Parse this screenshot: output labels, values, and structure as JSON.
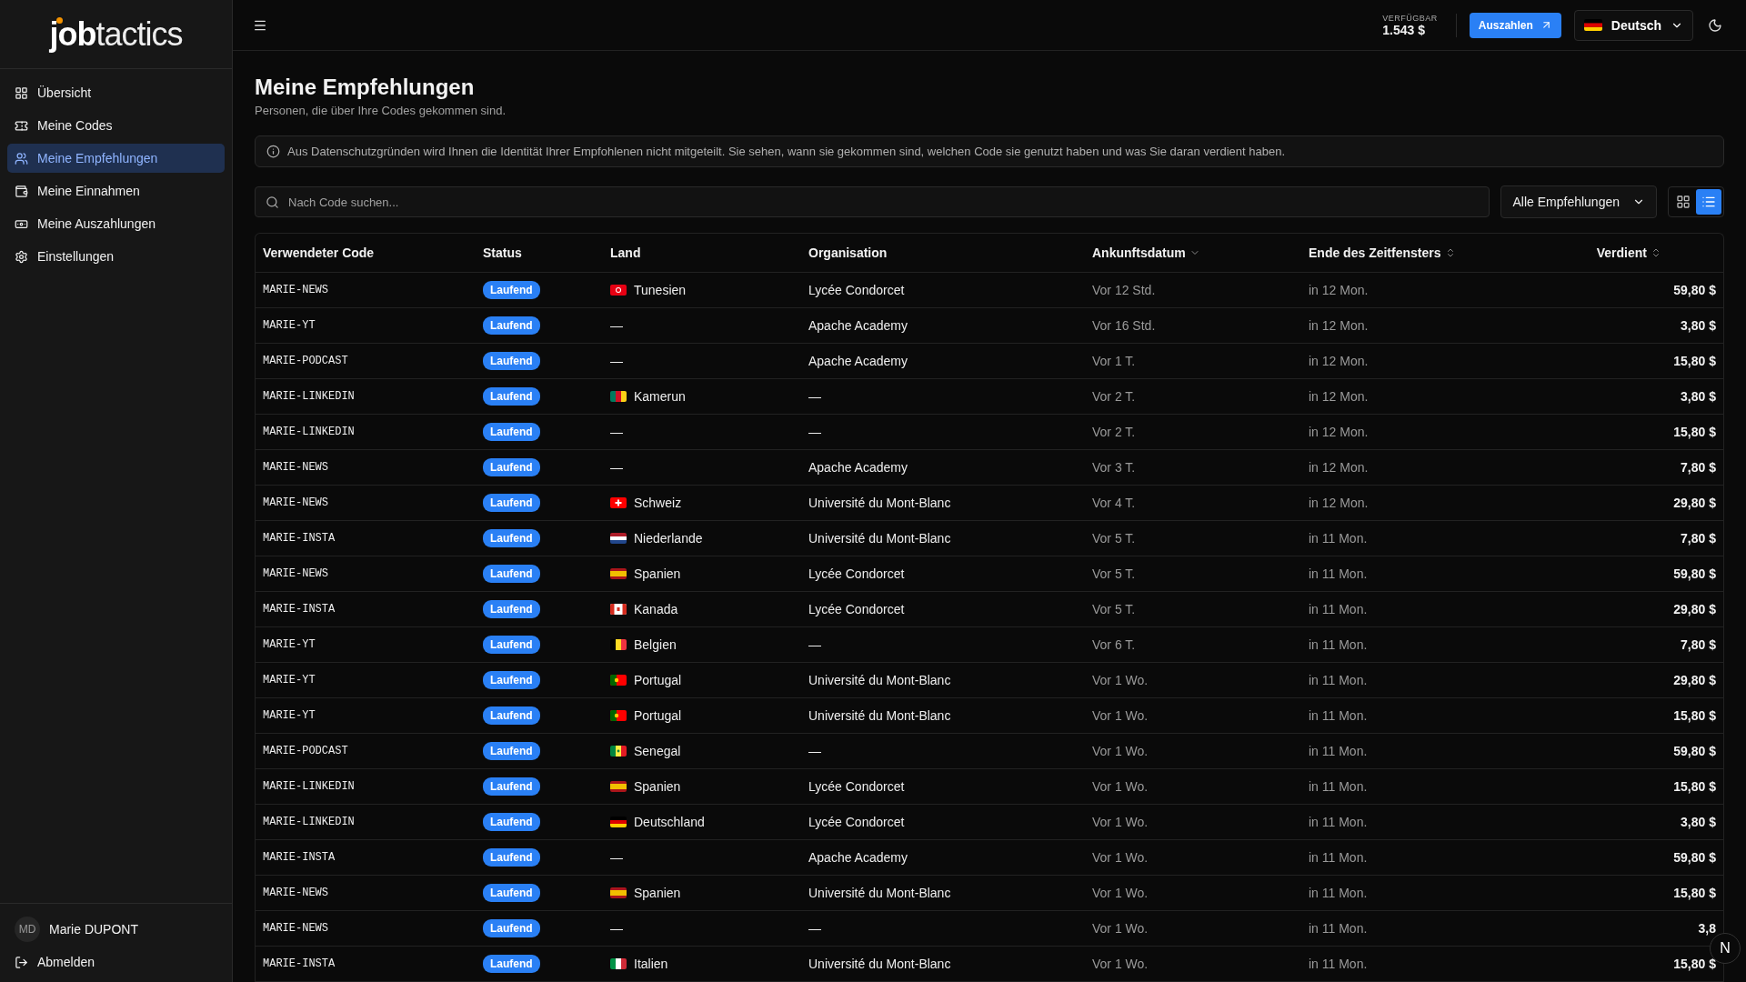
{
  "sidebar": {
    "logo": {
      "bold": "job",
      "light": "tactics"
    },
    "items": [
      {
        "label": "Übersicht",
        "selected": false
      },
      {
        "label": "Meine Codes",
        "selected": false
      },
      {
        "label": "Meine Empfehlungen",
        "selected": true
      },
      {
        "label": "Meine Einnahmen",
        "selected": false
      },
      {
        "label": "Meine Auszahlungen",
        "selected": false
      },
      {
        "label": "Einstellungen",
        "selected": false
      }
    ],
    "user": {
      "initials": "MD",
      "name": "Marie DUPONT"
    },
    "logout": "Abmelden"
  },
  "topbar": {
    "balance_label": "VERFÜGBAR",
    "balance": "1.543 $",
    "payout_button": "Auszahlen",
    "language": {
      "label": "Deutsch"
    }
  },
  "page": {
    "title": "Meine Empfehlungen",
    "subtitle": "Personen, die über Ihre Codes gekommen sind.",
    "notice": "Aus Datenschutzgründen wird Ihnen die Identität Ihrer Empfohlenen nicht mitgeteilt. Sie sehen, wann sie gekommen sind, welchen Code sie genutzt haben und was Sie daran verdient haben.",
    "search": {
      "placeholder": "Nach Code suchen..."
    },
    "filter": "Alle Empfehlungen",
    "views": [
      {
        "kind": "grid",
        "selected": false
      },
      {
        "kind": "list",
        "selected": true
      }
    ]
  },
  "table": {
    "columns": [
      {
        "label": "Verwendeter Code"
      },
      {
        "label": "Status"
      },
      {
        "label": "Land"
      },
      {
        "label": "Organisation"
      },
      {
        "label": "Ankunftsdatum"
      },
      {
        "label": "Ende des Zeitfensters"
      },
      {
        "label": "Verdient"
      }
    ],
    "rows": [
      {
        "code": "MARIE-NEWS",
        "status": "Laufend",
        "country": {
          "name": "Tunesien"
        },
        "organisation": "Lycée Condorcet",
        "arrival": "Vor 12 Std.",
        "window_end": "in 12 Mon.",
        "earned": "59,80 $"
      },
      {
        "code": "MARIE-YT",
        "status": "Laufend",
        "country": {
          "name": "—"
        },
        "organisation": "Apache Academy",
        "arrival": "Vor 16 Std.",
        "window_end": "in 12 Mon.",
        "earned": "3,80 $"
      },
      {
        "code": "MARIE-PODCAST",
        "status": "Laufend",
        "country": {
          "name": "—"
        },
        "organisation": "Apache Academy",
        "arrival": "Vor 1 T.",
        "window_end": "in 12 Mon.",
        "earned": "15,80 $"
      },
      {
        "code": "MARIE-LINKEDIN",
        "status": "Laufend",
        "country": {
          "name": "Kamerun"
        },
        "organisation": "—",
        "arrival": "Vor 2 T.",
        "window_end": "in 12 Mon.",
        "earned": "3,80 $"
      },
      {
        "code": "MARIE-LINKEDIN",
        "status": "Laufend",
        "country": {
          "name": "—"
        },
        "organisation": "—",
        "arrival": "Vor 2 T.",
        "window_end": "in 12 Mon.",
        "earned": "15,80 $"
      },
      {
        "code": "MARIE-NEWS",
        "status": "Laufend",
        "country": {
          "name": "—"
        },
        "organisation": "Apache Academy",
        "arrival": "Vor 3 T.",
        "window_end": "in 12 Mon.",
        "earned": "7,80 $"
      },
      {
        "code": "MARIE-NEWS",
        "status": "Laufend",
        "country": {
          "name": "Schweiz"
        },
        "organisation": "Université du Mont-Blanc",
        "arrival": "Vor 4 T.",
        "window_end": "in 12 Mon.",
        "earned": "29,80 $"
      },
      {
        "code": "MARIE-INSTA",
        "status": "Laufend",
        "country": {
          "name": "Niederlande"
        },
        "organisation": "Université du Mont-Blanc",
        "arrival": "Vor 5 T.",
        "window_end": "in 11 Mon.",
        "earned": "7,80 $"
      },
      {
        "code": "MARIE-NEWS",
        "status": "Laufend",
        "country": {
          "name": "Spanien"
        },
        "organisation": "Lycée Condorcet",
        "arrival": "Vor 5 T.",
        "window_end": "in 11 Mon.",
        "earned": "59,80 $"
      },
      {
        "code": "MARIE-INSTA",
        "status": "Laufend",
        "country": {
          "name": "Kanada"
        },
        "organisation": "Lycée Condorcet",
        "arrival": "Vor 5 T.",
        "window_end": "in 11 Mon.",
        "earned": "29,80 $"
      },
      {
        "code": "MARIE-YT",
        "status": "Laufend",
        "country": {
          "name": "Belgien"
        },
        "organisation": "—",
        "arrival": "Vor 6 T.",
        "window_end": "in 11 Mon.",
        "earned": "7,80 $"
      },
      {
        "code": "MARIE-YT",
        "status": "Laufend",
        "country": {
          "name": "Portugal"
        },
        "organisation": "Université du Mont-Blanc",
        "arrival": "Vor 1 Wo.",
        "window_end": "in 11 Mon.",
        "earned": "29,80 $"
      },
      {
        "code": "MARIE-YT",
        "status": "Laufend",
        "country": {
          "name": "Portugal"
        },
        "organisation": "Université du Mont-Blanc",
        "arrival": "Vor 1 Wo.",
        "window_end": "in 11 Mon.",
        "earned": "15,80 $"
      },
      {
        "code": "MARIE-PODCAST",
        "status": "Laufend",
        "country": {
          "name": "Senegal"
        },
        "organisation": "—",
        "arrival": "Vor 1 Wo.",
        "window_end": "in 11 Mon.",
        "earned": "59,80 $"
      },
      {
        "code": "MARIE-LINKEDIN",
        "status": "Laufend",
        "country": {
          "name": "Spanien"
        },
        "organisation": "Lycée Condorcet",
        "arrival": "Vor 1 Wo.",
        "window_end": "in 11 Mon.",
        "earned": "15,80 $"
      },
      {
        "code": "MARIE-LINKEDIN",
        "status": "Laufend",
        "country": {
          "name": "Deutschland"
        },
        "organisation": "Lycée Condorcet",
        "arrival": "Vor 1 Wo.",
        "window_end": "in 11 Mon.",
        "earned": "3,80 $"
      },
      {
        "code": "MARIE-INSTA",
        "status": "Laufend",
        "country": {
          "name": "—"
        },
        "organisation": "Apache Academy",
        "arrival": "Vor 1 Wo.",
        "window_end": "in 11 Mon.",
        "earned": "59,80 $"
      },
      {
        "code": "MARIE-NEWS",
        "status": "Laufend",
        "country": {
          "name": "Spanien"
        },
        "organisation": "Université du Mont-Blanc",
        "arrival": "Vor 1 Wo.",
        "window_end": "in 11 Mon.",
        "earned": "15,80 $"
      },
      {
        "code": "MARIE-NEWS",
        "status": "Laufend",
        "country": {
          "name": "—"
        },
        "organisation": "—",
        "arrival": "Vor 1 Wo.",
        "window_end": "in 11 Mon.",
        "earned": "3,8"
      },
      {
        "code": "MARIE-INSTA",
        "status": "Laufend",
        "country": {
          "name": "Italien"
        },
        "organisation": "Université du Mont-Blanc",
        "arrival": "Vor 1 Wo.",
        "window_end": "in 11 Mon.",
        "earned": "15,80 $"
      }
    ]
  },
  "dev_badge": "N"
}
